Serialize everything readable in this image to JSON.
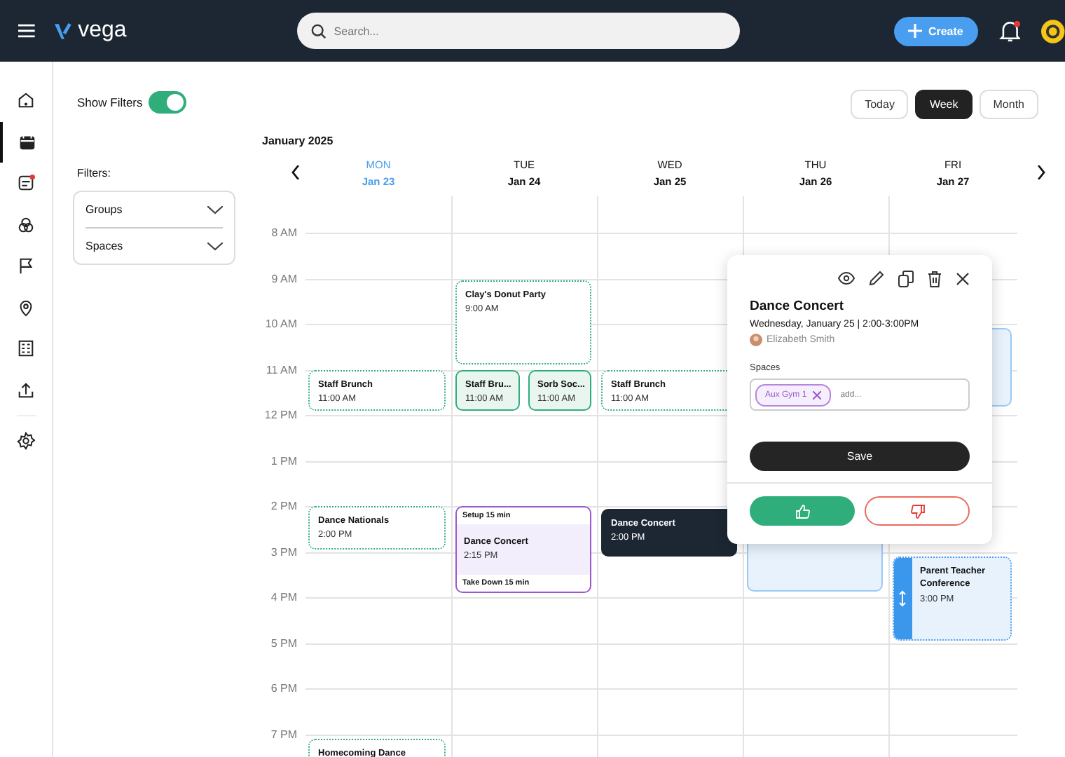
{
  "header": {
    "brand": "vega",
    "search": {
      "placeholder": "Search..."
    },
    "create_button": "Create",
    "notifications": {
      "unread": true
    }
  },
  "nav": [
    {
      "selected": false,
      "badge": false
    },
    {
      "selected": true,
      "badge": false
    },
    {
      "selected": false,
      "badge": true
    },
    {
      "selected": false,
      "badge": false
    },
    {
      "selected": false,
      "badge": false
    },
    {
      "selected": false,
      "badge": false
    },
    {
      "selected": false,
      "badge": false
    },
    {
      "selected": false,
      "badge": false
    },
    {
      "selected": false,
      "badge": false
    }
  ],
  "filters": {
    "show_filters": {
      "label": "Show Filters",
      "on": true
    },
    "title": "Filters:",
    "groups": [
      {
        "label": "Groups",
        "expanded": false
      },
      {
        "label": "Spaces",
        "expanded": false
      }
    ]
  },
  "view_switch": [
    {
      "label": "Today",
      "selected": false
    },
    {
      "label": "Week",
      "selected": true
    },
    {
      "label": "Month",
      "selected": false
    }
  ],
  "calendar": {
    "month": "January 2025",
    "hours": [
      "8 AM",
      "9 AM",
      "10 AM",
      "11 AM",
      "12 PM",
      "1 PM",
      "2 PM",
      "3 PM",
      "4 PM",
      "5 PM",
      "6 PM",
      "7 PM"
    ],
    "days": [
      {
        "weekday": "MON",
        "date": "Jan 23",
        "today": true,
        "events": [
          {
            "kind": "tentative",
            "selected": false,
            "title": "Staff Brunch",
            "time": "11:00 AM"
          },
          {
            "kind": "tentative",
            "selected": false,
            "title": "Dance Nationals",
            "time": "2:00 PM"
          },
          {
            "kind": "tentative",
            "selected": false,
            "title": "Homecoming Dance"
          }
        ]
      },
      {
        "weekday": "TUE",
        "date": "Jan 24",
        "today": false,
        "events": [
          {
            "kind": "tentative",
            "selected": false,
            "title": "Clay's Donut Party",
            "time": "9:00 AM"
          },
          {
            "kind": "confirmed",
            "selected": false,
            "title": "Staff Bru...",
            "time": "11:00 AM"
          },
          {
            "kind": "confirmed",
            "selected": false,
            "title": "Sorb Soc...",
            "time": "11:00 AM"
          },
          {
            "kind": "buffered",
            "selected": false,
            "setup": "Setup 15 min",
            "title": "Dance Concert",
            "time": "2:15 PM",
            "takedown": "Take Down 15 min"
          }
        ]
      },
      {
        "weekday": "WED",
        "date": "Jan 25",
        "today": false,
        "events": [
          {
            "kind": "tentative",
            "selected": false,
            "title": "Staff Brunch",
            "time": "11:00 AM"
          },
          {
            "kind": "tentative",
            "selected": true,
            "title": "Dance Concert",
            "time": "2:00 PM"
          }
        ]
      },
      {
        "weekday": "THU",
        "date": "Jan 26",
        "today": false,
        "events": [
          {
            "kind": "request"
          }
        ]
      },
      {
        "weekday": "FRI",
        "date": "Jan 27",
        "today": false,
        "events": [
          {
            "kind": "request"
          },
          {
            "kind": "resizing",
            "selected": false,
            "title": "Parent Teacher Conference",
            "time": "3:00 PM"
          }
        ]
      }
    ]
  },
  "popover": {
    "title": "Dance Concert",
    "when": "Wednesday, January 25 | 2:00-3:00PM",
    "owner": "Elizabeth Smith",
    "spaces_label": "Spaces",
    "spaces": [
      {
        "label": "Aux Gym 1"
      }
    ],
    "spaces_placeholder": "add...",
    "save_button": "Save"
  }
}
